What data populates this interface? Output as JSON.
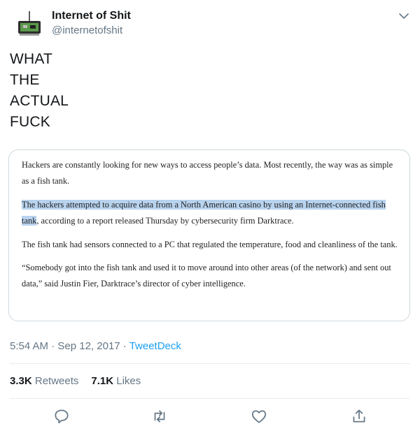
{
  "author": {
    "name": "Internet of Shit",
    "handle": "@internetofshit"
  },
  "tweet": {
    "lines": [
      "WHAT",
      "THE",
      "ACTUAL",
      "FUCK"
    ]
  },
  "article": {
    "p1": "Hackers are constantly looking for new ways to access people’s data. Most recently, the way was as simple as a fish tank.",
    "p2_highlight": "The hackers attempted to acquire data from a North American casino by using an Internet-connected fish tank",
    "p2_rest": ", according to a report released Thursday by cybersecurity firm Darktrace.",
    "p3": "The fish tank had sensors connected to a PC that regulated the temperature, food and cleanliness of the tank.",
    "p4": "“Somebody got into the fish tank and used it to move around into other areas (of the network) and sent out data,” said Justin Fier, Darktrace’s director of cyber intelligence."
  },
  "meta": {
    "time": "5:54 AM",
    "sep1": " · ",
    "date": "Sep 12, 2017",
    "sep2": " · ",
    "source": "TweetDeck"
  },
  "stats": {
    "retweets_count": "3.3K",
    "retweets_label": " Retweets",
    "likes_count": "7.1K",
    "likes_label": " Likes"
  },
  "actions": {
    "reply": "reply-icon",
    "retweet": "retweet-icon",
    "like": "heart-icon",
    "share": "share-icon"
  },
  "colors": {
    "accent": "#1da1f2",
    "secondary_text": "#657786",
    "highlight": "#b8d3ee"
  }
}
